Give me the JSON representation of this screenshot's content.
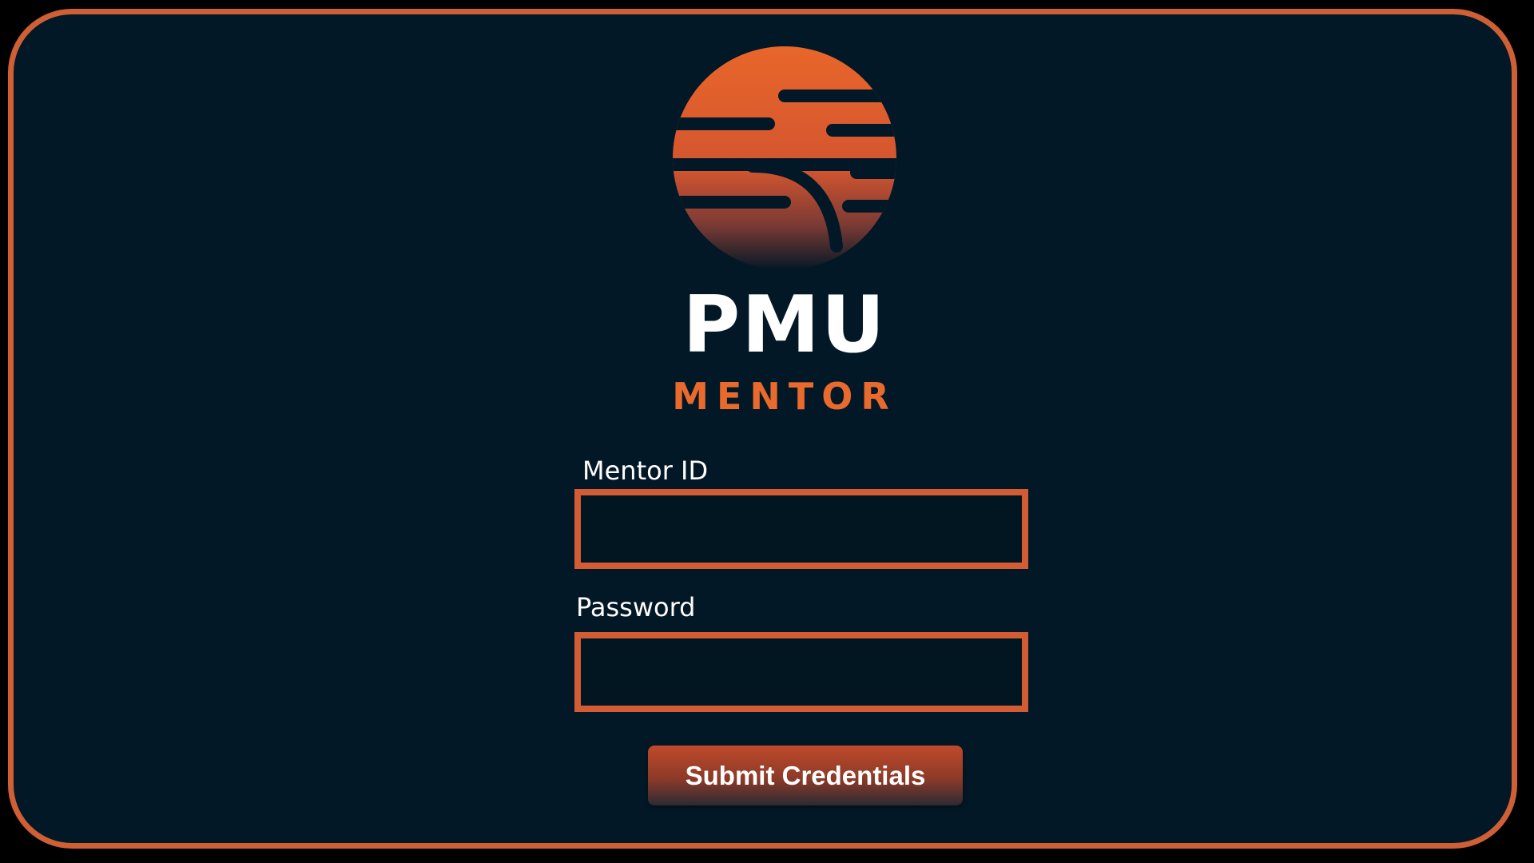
{
  "brand": {
    "logo_icon": "sun-stripes-logo-icon",
    "name_line1": "PMU",
    "name_line2": "MENTOR",
    "accent_color": "#cf5f34",
    "background_color": "#031826"
  },
  "login_form": {
    "mentor_id": {
      "label": "Mentor ID",
      "value": "",
      "placeholder": ""
    },
    "password": {
      "label": "Password",
      "value": "",
      "placeholder": ""
    },
    "submit_label": "Submit Credentials"
  }
}
